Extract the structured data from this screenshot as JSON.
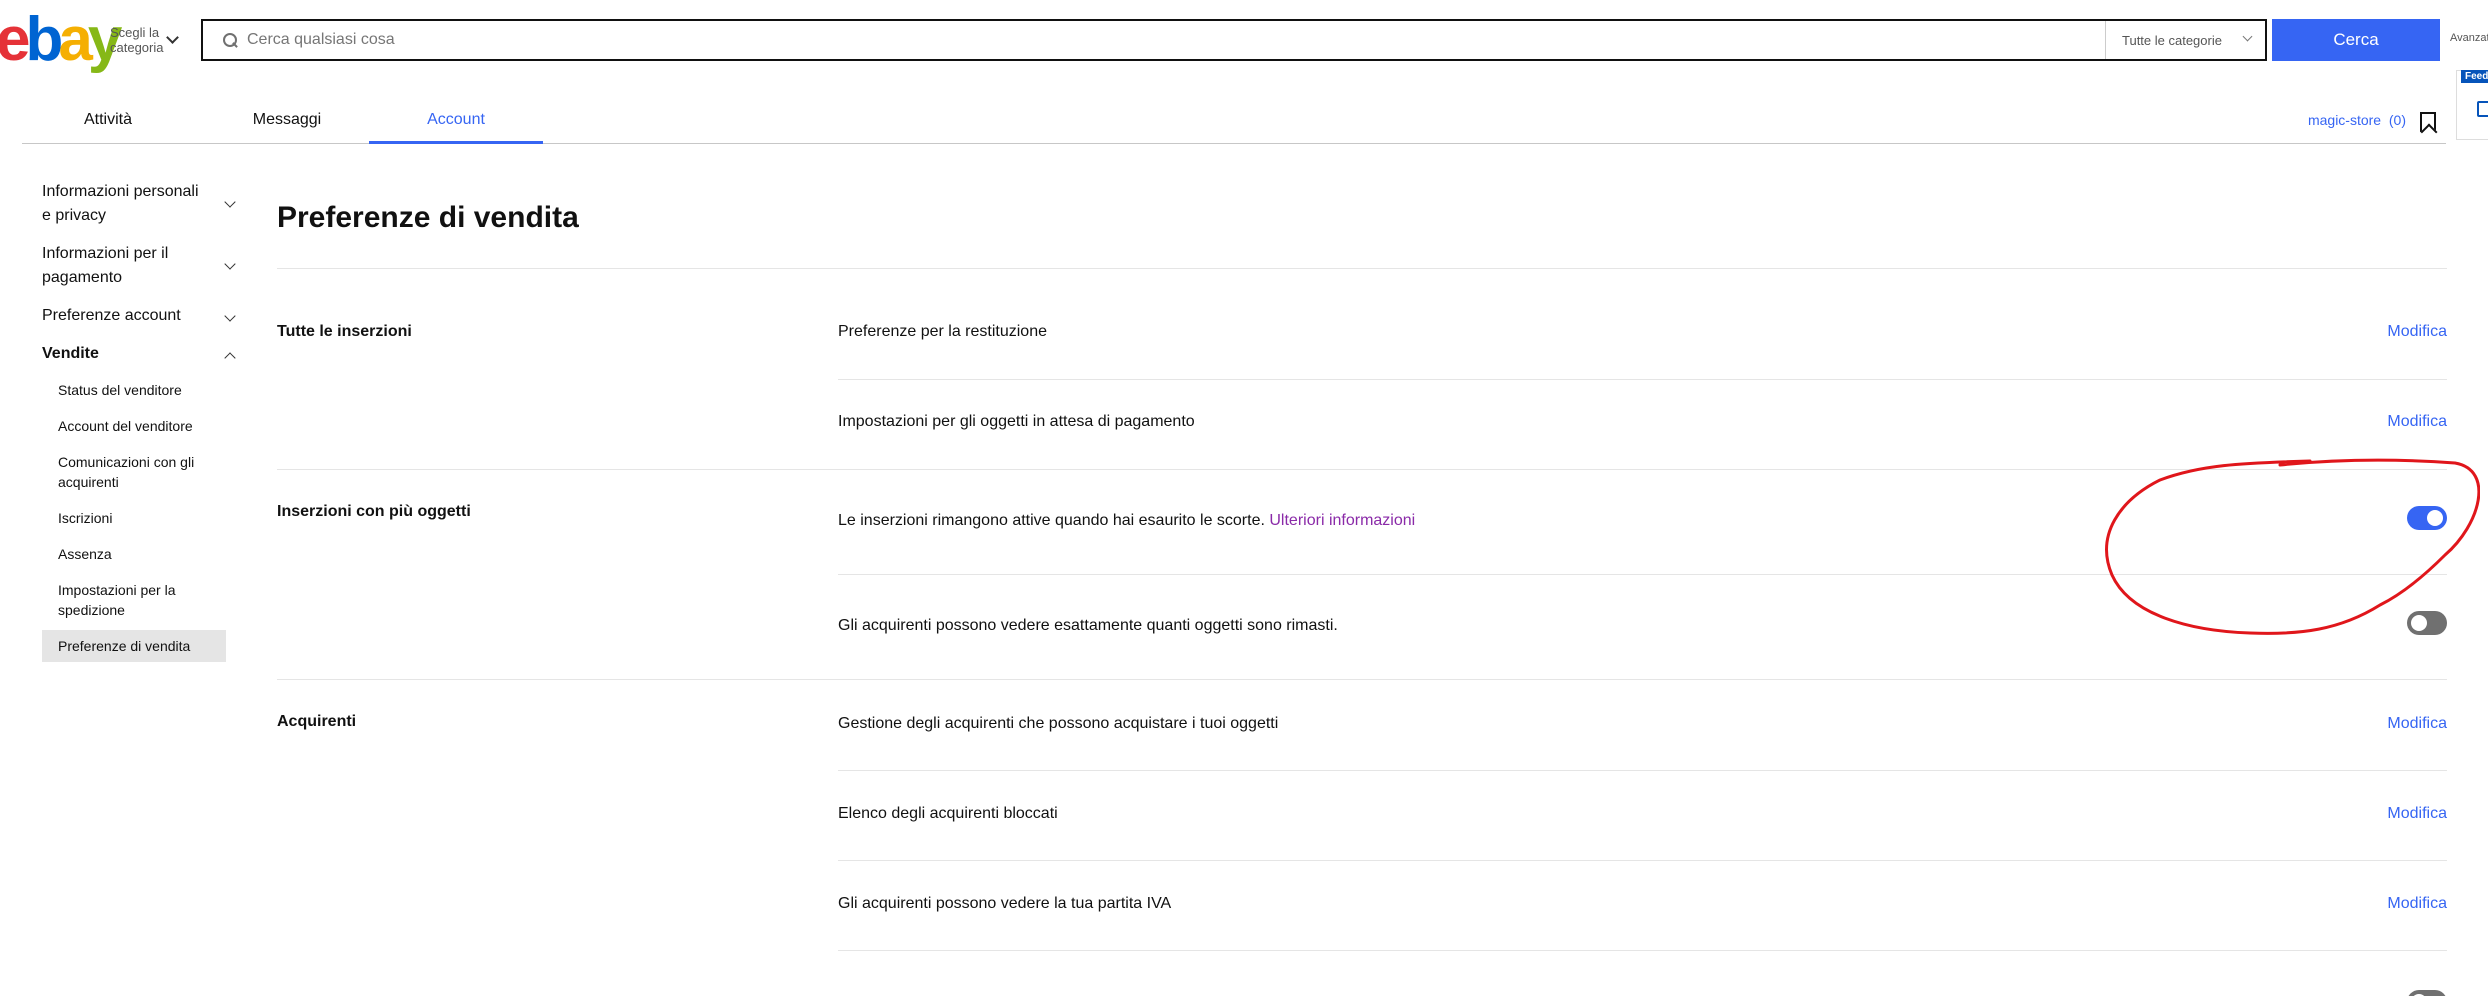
{
  "header": {
    "category_picker_label": "Scegli la categoria",
    "search_placeholder": "Cerca qualsiasi cosa",
    "category_select": "Tutte le categorie",
    "search_button": "Cerca",
    "advanced": "Avanzata",
    "feedback_tag": "Feed"
  },
  "tabs": [
    {
      "label": "Attività",
      "active": false
    },
    {
      "label": "Messaggi",
      "active": false
    },
    {
      "label": "Account",
      "active": true
    }
  ],
  "store": {
    "name": "magic-store",
    "count": "(0)"
  },
  "sidebar": {
    "groups": [
      {
        "label": "Informazioni personali e privacy"
      },
      {
        "label": "Informazioni per il pagamento"
      },
      {
        "label": "Preferenze account"
      },
      {
        "label": "Vendite"
      }
    ],
    "vendite_items": [
      "Status del venditore",
      "Account del venditore",
      "Comunicazioni con gli acquirenti",
      "Iscrizioni",
      "Assenza",
      "Impostazioni per la spedizione",
      "Preferenze di vendita"
    ]
  },
  "main": {
    "title": "Preferenze di vendita",
    "sections": [
      {
        "title": "Tutte le inserzioni",
        "rows": [
          {
            "text": "Preferenze per la restituzione",
            "action": "Modifica"
          },
          {
            "text": "Impostazioni per gli oggetti in attesa di pagamento",
            "action": "Modifica"
          }
        ]
      },
      {
        "title": "Inserzioni con più oggetti",
        "rows": [
          {
            "text": "Le inserzioni rimangono attive quando hai esaurito le scorte.",
            "link": "Ulteriori informazioni",
            "toggle": "on"
          },
          {
            "text": "Gli acquirenti possono vedere esattamente quanti oggetti sono rimasti.",
            "toggle": "off"
          }
        ]
      },
      {
        "title": "Acquirenti",
        "rows": [
          {
            "text": "Gestione degli acquirenti che possono acquistare i tuoi oggetti",
            "action": "Modifica"
          },
          {
            "text": "Elenco degli acquirenti bloccati",
            "action": "Modifica"
          },
          {
            "text": "Gli acquirenti possono vedere la tua partita IVA",
            "action": "Modifica"
          }
        ]
      }
    ]
  },
  "colors": {
    "accent": "#3665f3",
    "annotation": "#e0161b",
    "link_visited": "#8a2aa8"
  }
}
